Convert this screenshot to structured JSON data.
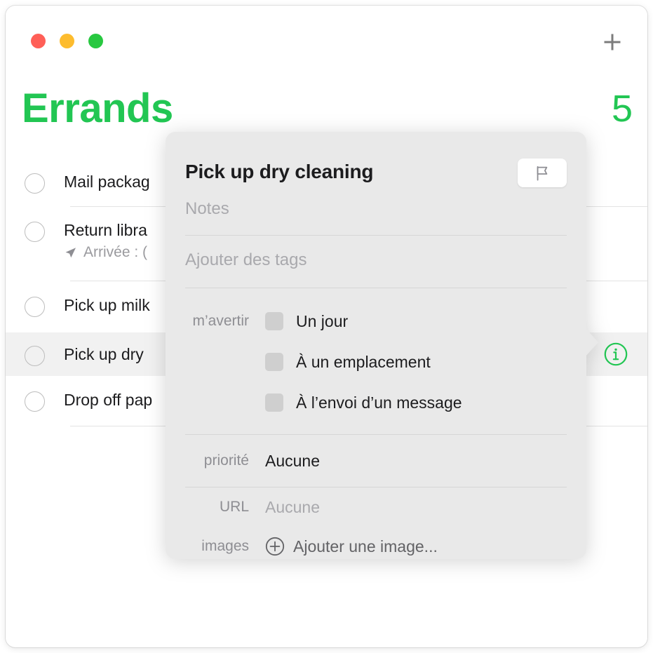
{
  "window": {
    "traffic_lights": [
      {
        "name": "close",
        "color": "#ff5f57"
      },
      {
        "name": "minimize",
        "color": "#fdbc2e"
      },
      {
        "name": "zoom",
        "color": "#28c840"
      }
    ],
    "add_icon": "plus-icon"
  },
  "list": {
    "title": "Errands",
    "count": "5",
    "accent_color": "#22c653",
    "items": [
      {
        "title": "Mail packag",
        "subtitle": "",
        "selected": false,
        "has_info": false
      },
      {
        "title": "Return libra",
        "subtitle": "Arrivée : (",
        "subtitle_icon": "location-arrow-icon",
        "selected": false,
        "has_info": false
      },
      {
        "title": "Pick up milk",
        "subtitle": "",
        "selected": false,
        "has_info": false
      },
      {
        "title": "Pick up dry",
        "subtitle": "",
        "selected": true,
        "has_info": true,
        "info_icon": "info-circle-icon"
      },
      {
        "title": "Drop off pap",
        "subtitle": "",
        "selected": false,
        "has_info": false
      }
    ]
  },
  "popover": {
    "title": "Pick up dry cleaning",
    "flag_icon": "flag-icon",
    "notes_placeholder": "Notes",
    "tags_placeholder": "Ajouter des tags",
    "alert": {
      "label": "m’avertir",
      "options": [
        {
          "label": "Un jour",
          "checked": false
        },
        {
          "label": "À un emplacement",
          "checked": false
        },
        {
          "label": "À l’envoi d’un message",
          "checked": false
        }
      ]
    },
    "priority": {
      "label": "priorité",
      "value": "Aucune"
    },
    "url": {
      "label": "URL",
      "value": "Aucune"
    },
    "images": {
      "label": "images",
      "action_label": "Ajouter une image...",
      "action_icon": "plus-circle-icon"
    }
  }
}
